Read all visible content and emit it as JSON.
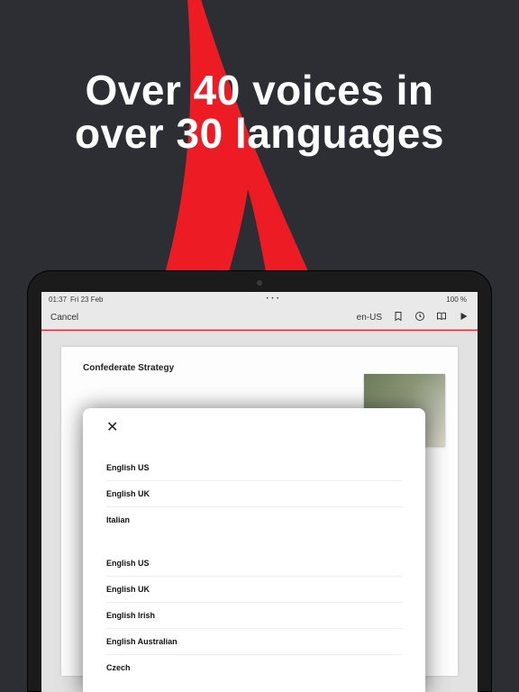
{
  "headline": {
    "line1": "Over 40 voices in",
    "line2": "over 30 languages"
  },
  "statusbar": {
    "time": "01:37",
    "date": "Fri 23 Feb",
    "battery": "100 %"
  },
  "toolbar": {
    "cancel_label": "Cancel",
    "locale_label": "en-US"
  },
  "document": {
    "title": "Confederate Strategy"
  },
  "sheet": {
    "groups": [
      {
        "items": [
          {
            "label": "English US"
          },
          {
            "label": "English UK"
          },
          {
            "label": "Italian"
          }
        ]
      },
      {
        "items": [
          {
            "label": "English US"
          },
          {
            "label": "English UK"
          },
          {
            "label": "English Irish"
          },
          {
            "label": "English Australian"
          },
          {
            "label": "Czech"
          }
        ]
      }
    ]
  }
}
